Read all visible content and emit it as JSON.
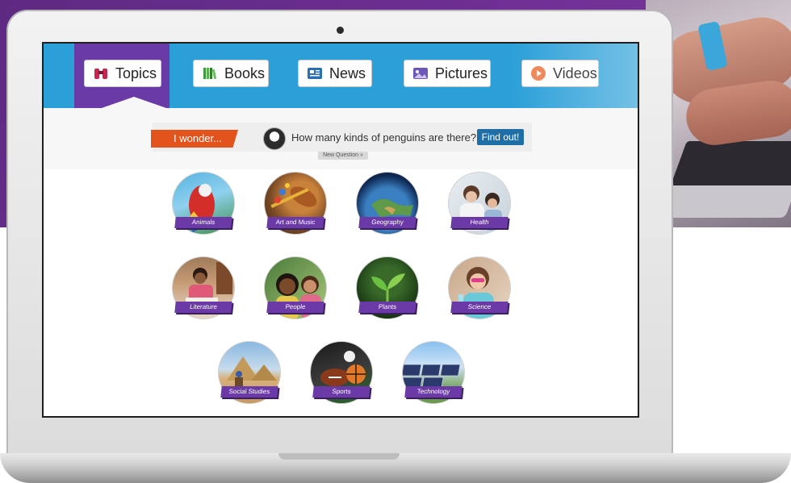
{
  "nav": {
    "tabs": [
      {
        "label": "Topics",
        "icon": "binoculars-icon",
        "active": true
      },
      {
        "label": "Books",
        "icon": "books-icon"
      },
      {
        "label": "News",
        "icon": "newspaper-icon"
      },
      {
        "label": "Pictures",
        "icon": "picture-icon"
      },
      {
        "label": "Videos",
        "icon": "play-icon"
      }
    ]
  },
  "wonder": {
    "tag": "I wonder...",
    "question": "How many kinds of penguins are there?",
    "button": "Find out!",
    "new_question": "New Question »"
  },
  "topics": [
    {
      "label": "Animals"
    },
    {
      "label": "Art and Music"
    },
    {
      "label": "Geography"
    },
    {
      "label": "Health"
    },
    {
      "label": "Literature"
    },
    {
      "label": "People"
    },
    {
      "label": "Plants"
    },
    {
      "label": "Science"
    },
    {
      "label": "Social Studies"
    },
    {
      "label": "Sports"
    },
    {
      "label": "Technology"
    }
  ],
  "colors": {
    "nav_blue": "#2a9fd8",
    "active_purple": "#6a3aa6",
    "wonder_orange": "#e2541c",
    "button_blue": "#1f6fa6"
  }
}
